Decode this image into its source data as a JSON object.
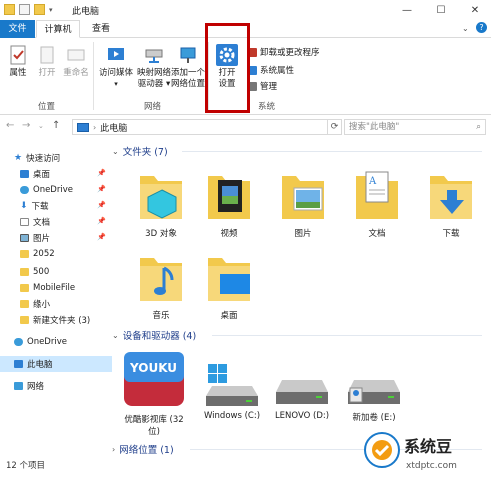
{
  "window": {
    "title": "此电脑",
    "controls": [
      "—",
      "☐",
      "✕"
    ]
  },
  "ribbon_tabs": [
    "文件",
    "计算机",
    "查看"
  ],
  "ribbon": {
    "location_group": {
      "label": "位置",
      "buttons": [
        "属性",
        "打开",
        "重命名"
      ]
    },
    "network_group": {
      "label": "网络",
      "buttons": [
        {
          "line1": "访问媒体",
          "line2": ""
        },
        {
          "line1": "映射网络",
          "line2": "驱动器 ▾"
        },
        {
          "line1": "添加一个",
          "line2": "网络位置"
        }
      ]
    },
    "system_group": {
      "label": "系统",
      "open_settings": {
        "line1": "打开",
        "line2": "设置"
      },
      "small": [
        "卸载或更改程序",
        "系统属性",
        "管理"
      ]
    },
    "colors": {
      "accent": "#1979ca",
      "highlight_box": "#c00000"
    }
  },
  "address": {
    "path": "此电脑",
    "refresh": "⟳",
    "search_placeholder": "搜索\"此电脑\""
  },
  "nav": {
    "quick_access": "快速访问",
    "items": [
      {
        "label": "桌面",
        "pinned": true,
        "icon": "desktop-icon"
      },
      {
        "label": "OneDrive",
        "pinned": true,
        "icon": "cloud-icon"
      },
      {
        "label": "下载",
        "pinned": true,
        "icon": "download-icon"
      },
      {
        "label": "文档",
        "pinned": true,
        "icon": "document-icon"
      },
      {
        "label": "图片",
        "pinned": true,
        "icon": "picture-icon"
      },
      {
        "label": "2052",
        "pinned": false,
        "icon": "folder-icon"
      },
      {
        "label": "500",
        "pinned": false,
        "icon": "folder-icon"
      },
      {
        "label": "MobileFile",
        "pinned": false,
        "icon": "folder-icon"
      },
      {
        "label": "缘小",
        "pinned": false,
        "icon": "folder-icon"
      },
      {
        "label": "新建文件夹 (3)",
        "pinned": false,
        "icon": "folder-icon"
      }
    ],
    "onedrive": "OneDrive",
    "this_pc": "此电脑",
    "network": "网络"
  },
  "folders_section": {
    "title": "文件夹 (7)",
    "items": [
      "3D 对象",
      "视频",
      "图片",
      "文档",
      "下载",
      "音乐",
      "桌面"
    ]
  },
  "devices_section": {
    "title": "设备和驱动器 (4)",
    "items": [
      {
        "label": "优酷影视库 (32",
        "label2": "位)",
        "kind": "youku",
        "brand": "YOUKU"
      },
      {
        "label": "Windows (C:)",
        "label2": "",
        "kind": "windows"
      },
      {
        "label": "LENOVO (D:)",
        "label2": "",
        "kind": "drive"
      },
      {
        "label": "新加卷 (E:)",
        "label2": "",
        "kind": "drive-user"
      }
    ]
  },
  "network_section": {
    "title": "网络位置 (1)"
  },
  "status": {
    "count": "12 个项目"
  },
  "watermark": {
    "name": "系统豆",
    "url": "xtdptc.com"
  }
}
